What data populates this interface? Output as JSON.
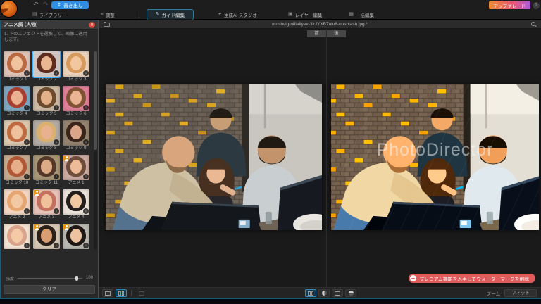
{
  "app": {
    "export_label": "書き出し",
    "upgrade_label": "アップグレード",
    "help_label": "?",
    "tabs": [
      {
        "label": "ライブラリー",
        "icon": "library-icon",
        "active": false
      },
      {
        "label": "調整",
        "icon": "adjust-icon",
        "active": false,
        "divider_after": true
      },
      {
        "label": "ガイド編集",
        "icon": "guided-edit-icon",
        "active": true
      },
      {
        "label": "生成AI スタジオ",
        "icon": "generative-ai-icon",
        "active": false
      },
      {
        "label": "レイヤー編集",
        "icon": "layer-edit-icon",
        "active": false
      },
      {
        "label": "一括編集",
        "icon": "batch-edit-icon",
        "active": false
      }
    ]
  },
  "sidebar": {
    "title": "アニメ調 (人物)",
    "instruction": "1. 下のエフェクトを選択して、画像に適用します。",
    "intensity_label": "強度",
    "intensity_value": "100",
    "clear_label": "クリア",
    "thumbnails": [
      {
        "label": "コミック 1",
        "selected": false,
        "premium": false,
        "bg": "#dfc2b6",
        "hair": "#b96a43",
        "skin": "#f0c49e"
      },
      {
        "label": "コミック 2",
        "selected": true,
        "premium": false,
        "bg": "#cfc6c2",
        "hair": "#5e2d20",
        "skin": "#eab793"
      },
      {
        "label": "コミック 3",
        "selected": false,
        "premium": false,
        "bg": "#ead3bd",
        "hair": "#d69a5e",
        "skin": "#f2c79f"
      },
      {
        "label": "コミック 4",
        "selected": false,
        "premium": false,
        "bg": "#7fa6c0",
        "hair": "#a63f2f",
        "skin": "#eab08f"
      },
      {
        "label": "コミック 5",
        "selected": false,
        "premium": false,
        "bg": "#cbb9a4",
        "hair": "#6b4a2e",
        "skin": "#e2b089"
      },
      {
        "label": "コミック 6",
        "selected": false,
        "premium": false,
        "bg": "#de7f98",
        "hair": "#7e5233",
        "skin": "#eab394"
      },
      {
        "label": "コミック 7",
        "selected": false,
        "premium": false,
        "bg": "#d9c6ae",
        "hair": "#bf6b3f",
        "skin": "#eec09c"
      },
      {
        "label": "コミック 8",
        "selected": false,
        "premium": false,
        "bg": "#b3aaa2",
        "hair": "#d9b06e",
        "skin": "#e9b18d"
      },
      {
        "label": "コミック 9",
        "selected": false,
        "premium": false,
        "bg": "#93826f",
        "hair": "#3a241a",
        "skin": "#dba58a"
      },
      {
        "label": "コミック 10",
        "selected": false,
        "premium": false,
        "bg": "#c4a98e",
        "hair": "#b05835",
        "skin": "#e7ae8a"
      },
      {
        "label": "コミック 11",
        "selected": false,
        "premium": false,
        "bg": "#a79576",
        "hair": "#54392a",
        "skin": "#ddab87"
      },
      {
        "label": "アニメ 1",
        "selected": false,
        "premium": true,
        "bg": "#c9a9a0",
        "hair": "#6e4c3a",
        "skin": "#eebb98"
      },
      {
        "label": "アニメ 2",
        "selected": false,
        "premium": false,
        "bg": "#f2d6c3",
        "hair": "#e5a671",
        "skin": "#f3c9a4"
      },
      {
        "label": "アニメ 3",
        "selected": false,
        "premium": true,
        "bg": "#e7c2b8",
        "hair": "#c4725f",
        "skin": "#f0c19b"
      },
      {
        "label": "アニメ 4",
        "selected": false,
        "premium": false,
        "bg": "#eae2d8",
        "hair": "#241d1b",
        "skin": "#f2c8a2"
      },
      {
        "label": "",
        "selected": false,
        "premium": false,
        "bg": "#f3e2d2",
        "hair": "#d9a48b",
        "skin": "#f4cba6"
      },
      {
        "label": "",
        "selected": false,
        "premium": true,
        "bg": "#d6c6b4",
        "hair": "#2b211a",
        "skin": "#d99f73"
      },
      {
        "label": "",
        "selected": false,
        "premium": true,
        "bg": "#b9b8b1",
        "hair": "#1f1815",
        "skin": "#eec3a1"
      }
    ]
  },
  "main": {
    "filename": "mushvig-niftaliyev-3kJYXB7uln8-unsplash.jpg *",
    "before_label": "前",
    "after_label": "後",
    "watermark": "PhotoDirector",
    "premium_banner": "プレミアム機能を入手してウォーターマークを削除"
  },
  "bottom_bar": {
    "zoom_label": "ズーム",
    "fit_label": "フィット"
  },
  "colors": {
    "accent_blue": "#2f8de4",
    "active_tab_border": "#2c7d9e",
    "selection_blue": "#3fa9f5",
    "premium_orange": "#e8920f",
    "banner_rose": "#e25b5b",
    "close_red": "#d24a3e"
  }
}
